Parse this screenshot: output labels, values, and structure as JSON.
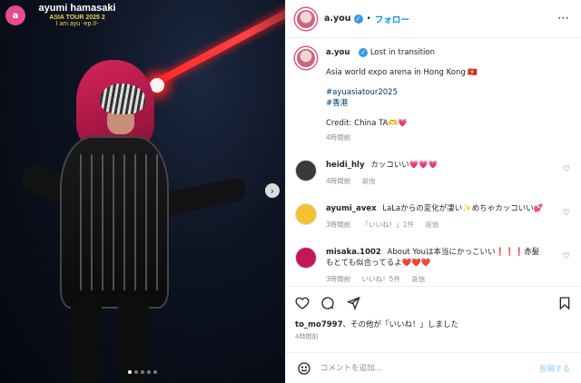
{
  "photo": {
    "tour_title": "ayumi hamasaki",
    "tour_subtitle": "ASIA TOUR 2025 2",
    "tour_tagline": "I am ayu -ep.II-",
    "logo_text": "a",
    "next_icon": "chevron-right-icon",
    "slide_count": 5,
    "active_slide": 1
  },
  "header": {
    "username": "a.you",
    "verified_icon": "✓",
    "separator": "•",
    "follow_label": "フォロー",
    "more_icon": "⋯"
  },
  "caption": {
    "username": "a.you",
    "line1": "Lost in transition",
    "line2": "Asia world expo arena in Hong Kong 🇭🇰",
    "hashtags": [
      "#ayuasiatour2025",
      "#香港"
    ],
    "credit": "Credit: China TA🫶💗",
    "time": "4時間前"
  },
  "comments": [
    {
      "user": "heidi_hly",
      "text": "カッコいい💗💗💗",
      "meta": [
        "4時間前",
        "返信"
      ],
      "avatar_color": "#3a3a3a"
    },
    {
      "user": "ayumi_avex",
      "text": "LaLaからの変化が凄い✨めちゃカッコいい💕",
      "meta": [
        "3時間前",
        "「いいね！」1件",
        "返信"
      ],
      "avatar_color": "#f2c230"
    },
    {
      "user": "misaka.1002",
      "text": "About Youは本当にかっこいい❗❗❗赤髪もとても似合ってるよ❤️❤️❤️",
      "meta": [
        "3時間前",
        "いいね！5件",
        "返信"
      ],
      "avatar_color": "#c2185b"
    }
  ],
  "likes": {
    "user": "to_mo7997",
    "rest": "、その他が「いいね！」しました",
    "time": "4時間前"
  },
  "add_comment": {
    "placeholder": "コメントを追加...",
    "post_label": "投稿する"
  },
  "colors": {
    "link": "#0095f6",
    "verified": "#3897f0",
    "muted": "#8e8e8e"
  }
}
